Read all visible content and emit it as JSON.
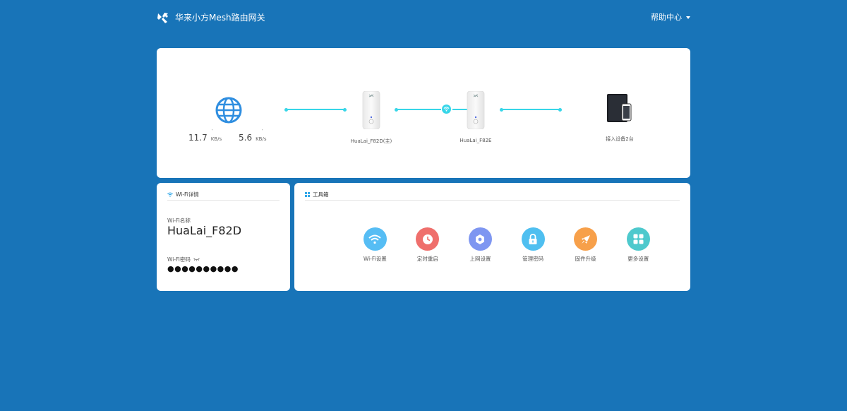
{
  "header": {
    "title": "华来小方Mesh路由网关",
    "help_label": "帮助中心"
  },
  "topology": {
    "download_speed": "11.7",
    "download_unit": "KB/s",
    "upload_speed": "5.6",
    "upload_unit": "KB/s",
    "main_router_name": "HuaLai_F82D(主)",
    "sub_router_name": "HuaLai_F82E",
    "devices_label": "接入设备2台"
  },
  "wifi": {
    "title": "Wi-Fi详情",
    "name_label": "Wi-Fi名称",
    "name_value": "HuaLai_F82D",
    "password_label": "Wi-Fi密码",
    "password_value": "●●●●●●●●●●"
  },
  "tools": {
    "title": "工具箱",
    "items": [
      {
        "label": "Wi-Fi设置",
        "icon": "wifi-icon",
        "color": "#56bdf4"
      },
      {
        "label": "定时重启",
        "icon": "clock-icon",
        "color": "#ef6f6c"
      },
      {
        "label": "上网设置",
        "icon": "hexagon-icon",
        "color": "#7e96f1"
      },
      {
        "label": "管理密码",
        "icon": "lock-icon",
        "color": "#4fbff0"
      },
      {
        "label": "固件升级",
        "icon": "rocket-icon",
        "color": "#f7a04a"
      },
      {
        "label": "更多设置",
        "icon": "grid-icon",
        "color": "#4ec9cd"
      }
    ]
  },
  "colors": {
    "background": "#1874b8",
    "accent_line": "#38d6e8",
    "globe": "#2f8ee0"
  }
}
